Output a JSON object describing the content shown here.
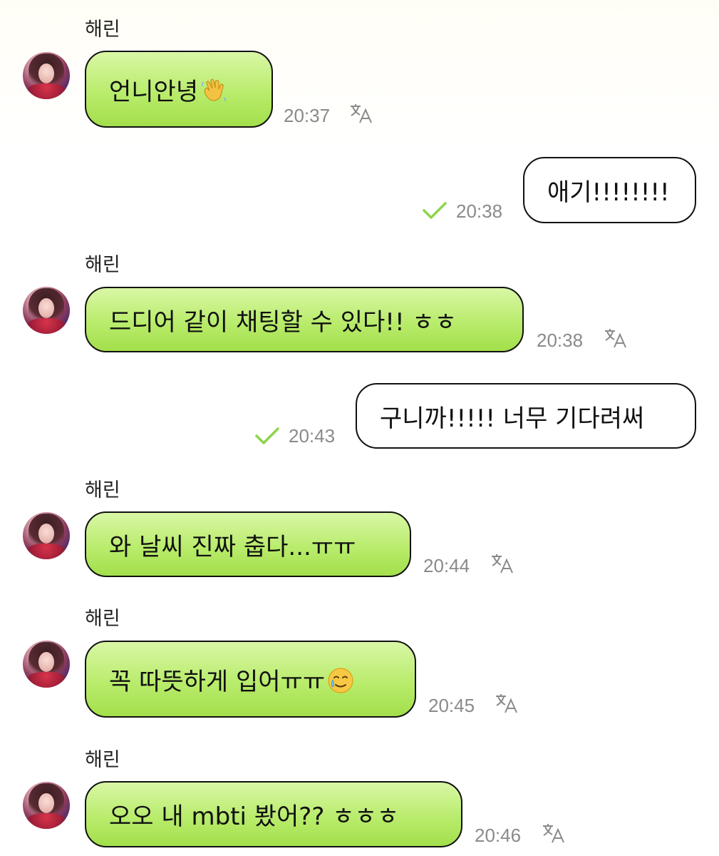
{
  "messages": [
    {
      "sender": "해린",
      "text": "언니안녕",
      "emoji": "waving-hand",
      "time": "20:37"
    },
    {
      "text": "애기!!!!!!!!",
      "time": "20:38",
      "status": "read"
    },
    {
      "sender": "해린",
      "text": "드디어 같이 채팅할 수 있다!! ㅎㅎ",
      "time": "20:38"
    },
    {
      "text": "구니까!!!!! 너무 기다려써",
      "time": "20:43",
      "status": "read"
    },
    {
      "sender": "해린",
      "text": "와 날씨 진짜 춥다...ㅠㅠ",
      "time": "20:44"
    },
    {
      "sender": "해린",
      "text": "꼭 따뜻하게 입어ㅠㅠ",
      "emoji": "crying-smile",
      "time": "20:45"
    },
    {
      "sender": "해린",
      "text": "오오 내 mbti 봤어?? ㅎㅎㅎ",
      "time": "20:46"
    }
  ],
  "colors": {
    "incoming_bubble_top": "#d9f7a6",
    "incoming_bubble_bottom": "#a3df4b",
    "outgoing_bubble": "#ffffff",
    "timestamp": "#8a8a8a",
    "read_check": "#8fd44a"
  },
  "icons": {
    "translate": "translate-icon",
    "read": "check-icon"
  }
}
